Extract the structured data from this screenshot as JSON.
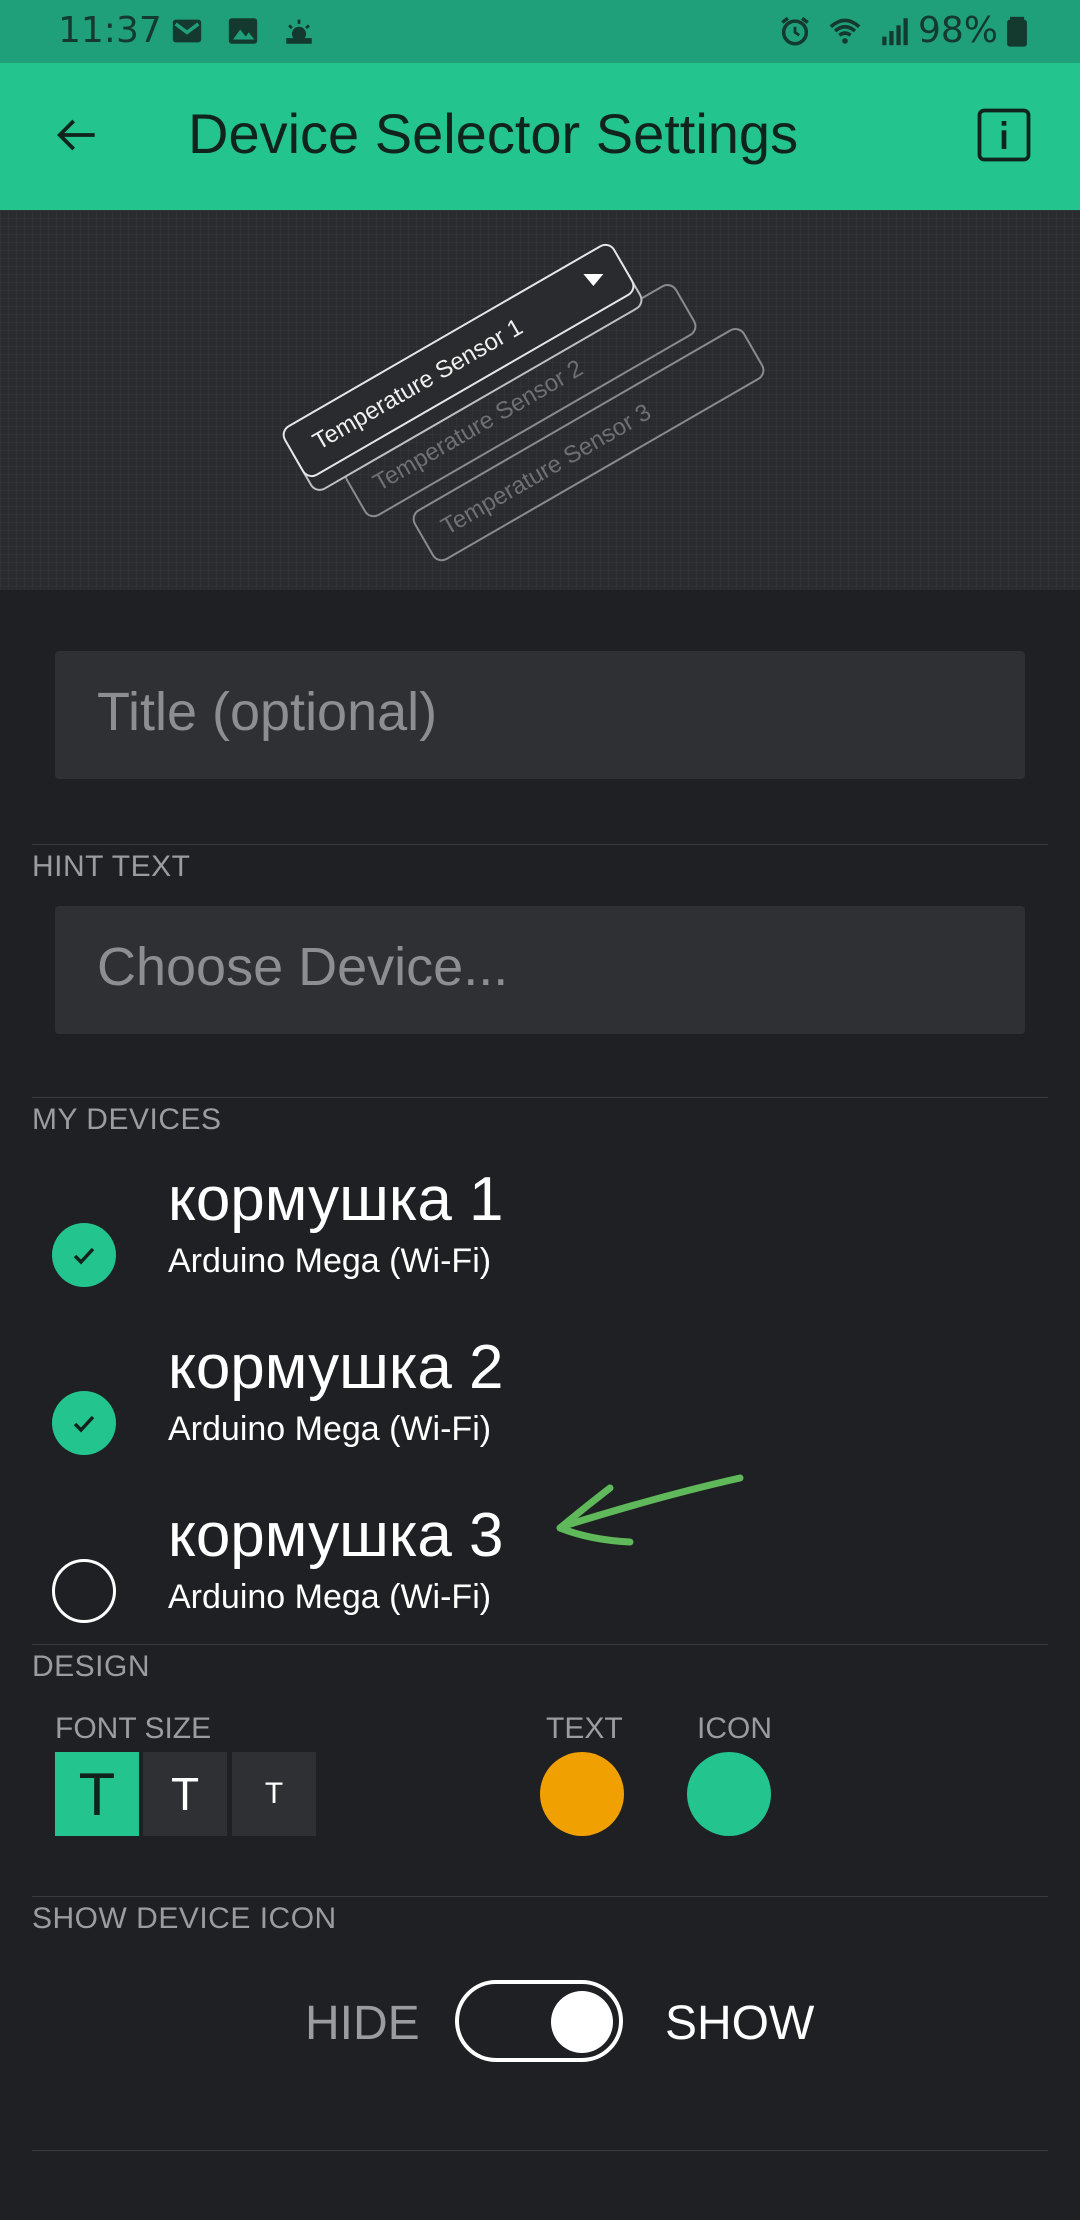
{
  "status_bar": {
    "time": "11:37",
    "battery": "98%",
    "icons_left": [
      "gmail-icon",
      "image-icon",
      "weather-icon"
    ],
    "icons_right": [
      "alarm-icon",
      "wifi-icon",
      "signal-icon",
      "battery-icon"
    ]
  },
  "app_bar": {
    "title": "Device Selector Settings",
    "back_icon": "back-arrow-icon",
    "info_icon": "info-icon"
  },
  "preview": {
    "items": [
      "Temperature Sensor 1",
      "Temperature Sensor 2",
      "Temperature Sensor 3"
    ]
  },
  "title_field": {
    "placeholder": "Title (optional)"
  },
  "hint_section": {
    "label": "HINT TEXT",
    "placeholder": "Choose Device..."
  },
  "devices_section": {
    "label": "MY DEVICES",
    "devices": [
      {
        "name": "кормушка 1",
        "type": "Arduino Mega (Wi-Fi)",
        "checked": true
      },
      {
        "name": "кормушка 2",
        "type": "Arduino Mega (Wi-Fi)",
        "checked": true
      },
      {
        "name": "кормушка 3",
        "type": "Arduino Mega (Wi-Fi)",
        "checked": false
      }
    ]
  },
  "design_section": {
    "label": "DESIGN",
    "font_size_label": "FONT SIZE",
    "font_sizes": [
      "T",
      "T",
      "T"
    ],
    "selected_font_size": 0,
    "text_label": "TEXT",
    "icon_label": "ICON",
    "text_color": "#f0a000",
    "icon_color": "#23c48e"
  },
  "show_icon_section": {
    "label": "SHOW DEVICE ICON",
    "off_label": "HIDE",
    "on_label": "SHOW",
    "value": true
  },
  "colors": {
    "accent": "#23c48e",
    "background": "#1f2023",
    "annotation_arrow": "#5fb85a"
  }
}
